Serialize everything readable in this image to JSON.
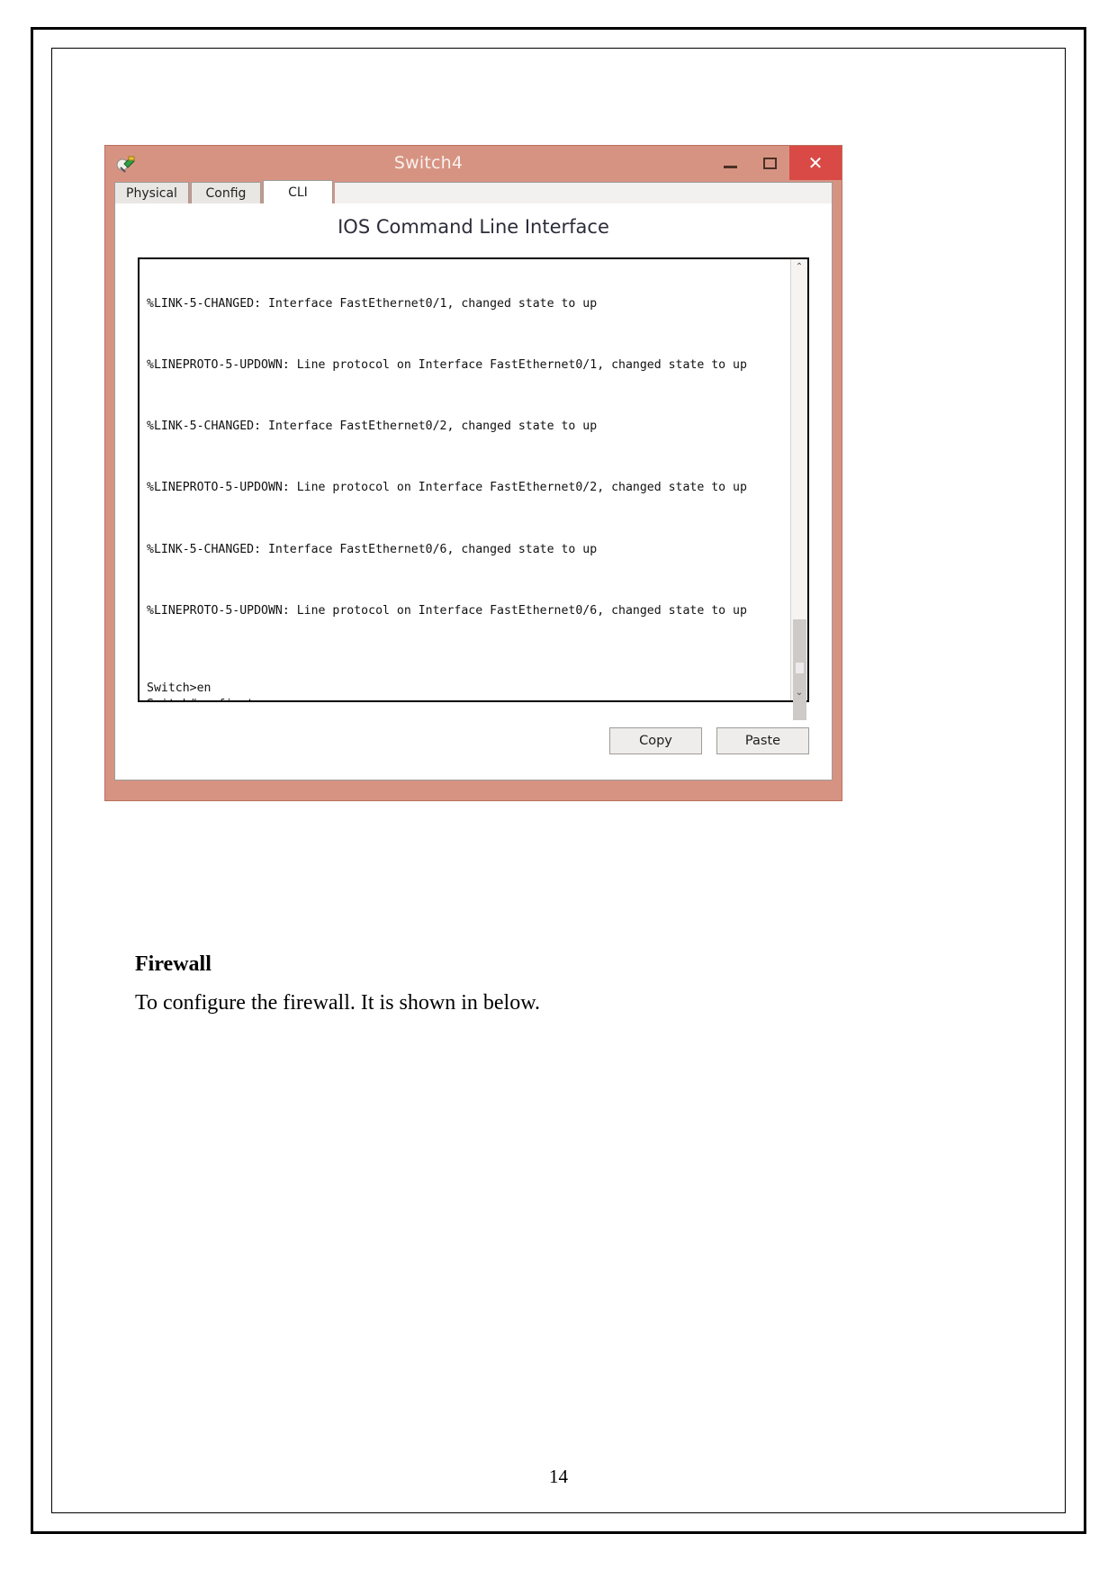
{
  "document": {
    "heading": "Firewall",
    "paragraph": "To configure the firewall. It is shown in below.",
    "page_number": "14"
  },
  "window": {
    "title": "Switch4",
    "app_icon": "packet-tracer-switch-icon",
    "controls": {
      "minimize": "–",
      "maximize": "□",
      "close": "✕",
      "close_color": "#d94a46"
    },
    "titlebar_color": "#d79382",
    "tabs": [
      {
        "label": "Physical",
        "active": false
      },
      {
        "label": "Config",
        "active": false
      },
      {
        "label": "CLI",
        "active": true
      }
    ],
    "cli_heading": "IOS Command Line Interface",
    "buttons": {
      "copy": "Copy",
      "paste": "Paste"
    },
    "scrollbar": {
      "up_arrow": "⌃",
      "down_arrow": "⌄"
    }
  },
  "console": {
    "log_blocks": [
      "%LINK-5-CHANGED: Interface FastEthernet0/1, changed state to up",
      "%LINEPROTO-5-UPDOWN: Line protocol on Interface FastEthernet0/1, changed state to up",
      "%LINK-5-CHANGED: Interface FastEthernet0/2, changed state to up",
      "%LINEPROTO-5-UPDOWN: Line protocol on Interface FastEthernet0/2, changed state to up",
      "%LINK-5-CHANGED: Interface FastEthernet0/6, changed state to up",
      "%LINEPROTO-5-UPDOWN: Line protocol on Interface FastEthernet0/6, changed state to up"
    ],
    "session": "Switch>en\nSwitch#config t\nEnter configuration commands, one per line.  End with CNTL/Z.\nSwitch(config)#vlan 3\nSwitch(config-vlan)#interface fa0/1\nSwitch(config-if)#switchport mode access\nSwitch(config-if)#switchport access vlan 3\nSwitch(config-if)#no shut\nSwitch(config-if)#interface fa0/2\nSwitch(config-if)#switchport mode access\nSwitch(config-if)#switchport access vlan 3\nSwitch(config-if)#no shut\nSwitch(config-if)#"
  }
}
